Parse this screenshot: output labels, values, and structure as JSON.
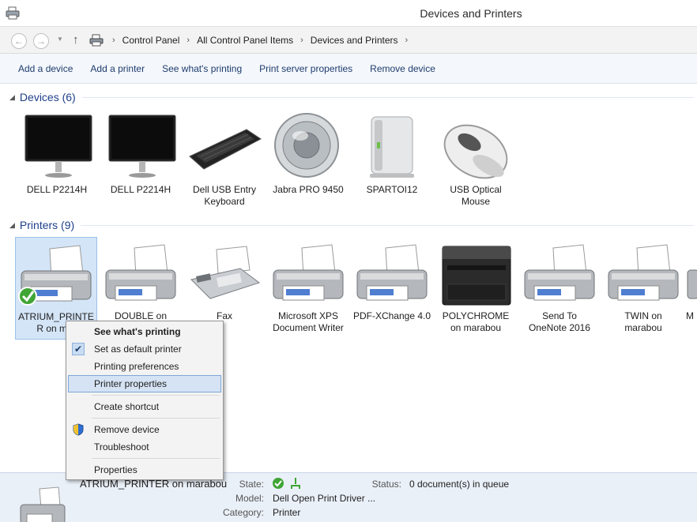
{
  "window": {
    "title": "Devices and Printers"
  },
  "address": {
    "back_icon": "back-arrow-icon",
    "forward_icon": "forward-arrow-icon",
    "up_icon": "up-arrow-icon",
    "breadcrumbs": [
      "Control Panel",
      "All Control Panel Items",
      "Devices and Printers"
    ]
  },
  "commands": [
    "Add a device",
    "Add a printer",
    "See what's printing",
    "Print server properties",
    "Remove device"
  ],
  "groups": {
    "devices": {
      "label": "Devices (6)",
      "items": [
        {
          "label": "DELL P2214H",
          "icon": "monitor-icon"
        },
        {
          "label": "DELL P2214H",
          "icon": "monitor-icon"
        },
        {
          "label": "Dell USB Entry\nKeyboard",
          "icon": "keyboard-icon"
        },
        {
          "label": "Jabra PRO 9450",
          "icon": "speaker-icon"
        },
        {
          "label": "SPARTOI12",
          "icon": "computer-tower-icon"
        },
        {
          "label": "USB Optical\nMouse",
          "icon": "mouse-icon"
        }
      ]
    },
    "printers": {
      "label": "Printers (9)",
      "items": [
        {
          "label": "ATRIUM_PRINTE\nR on mar",
          "icon": "printer-icon",
          "default": true
        },
        {
          "label": "DOUBLE on",
          "icon": "printer-icon"
        },
        {
          "label": "Fax",
          "icon": "fax-icon"
        },
        {
          "label": "Microsoft XPS\nDocument Writer",
          "icon": "printer-icon"
        },
        {
          "label": "PDF-XChange 4.0",
          "icon": "printer-icon"
        },
        {
          "label": "POLYCHROME\non marabou",
          "icon": "laser-printer-icon"
        },
        {
          "label": "Send To\nOneNote 2016",
          "icon": "printer-icon"
        },
        {
          "label": "TWIN on\nmarabou",
          "icon": "printer-icon"
        },
        {
          "label": "M",
          "icon": "printer-icon"
        }
      ]
    }
  },
  "context_menu": {
    "items": [
      {
        "label": "See what's printing",
        "bold": true
      },
      {
        "label": "Set as default printer",
        "checked": true
      },
      {
        "label": "Printing preferences"
      },
      {
        "label": "Printer properties",
        "highlighted": true
      },
      {
        "label": "Create shortcut"
      },
      {
        "label": "Remove device",
        "icon": "uac-shield-icon"
      },
      {
        "label": "Troubleshoot"
      },
      {
        "label": "Properties"
      }
    ]
  },
  "details": {
    "name": "ATRIUM_PRINTER on marabou",
    "state_label": "State:",
    "status_label": "Status:",
    "status_value": "0 document(s) in queue",
    "model_label": "Model:",
    "model_value": "Dell Open Print Driver ...",
    "category_label": "Category:",
    "category_value": "Printer"
  },
  "colors": {
    "accent_blue": "#1e3f8a",
    "selection": "#d4e5f7",
    "menu_highlight": "#d5e3f4"
  }
}
